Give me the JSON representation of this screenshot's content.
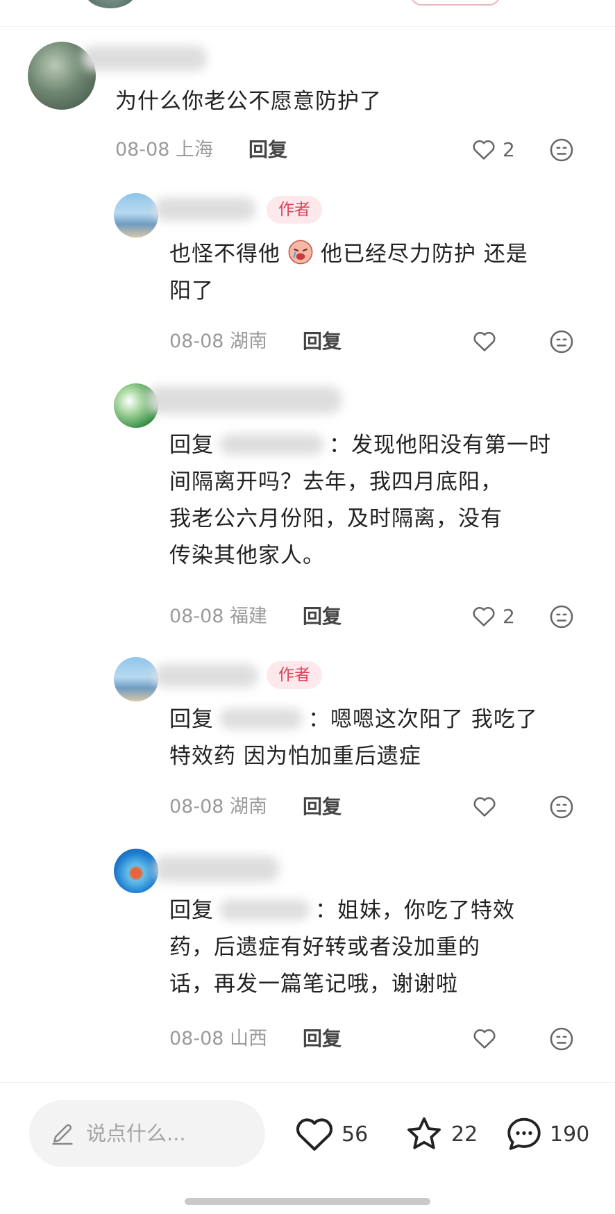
{
  "comments": [
    {
      "content": "为什么你老公不愿意防护了",
      "date": "08-08 上海",
      "reply_label": "回复",
      "likes": "2"
    },
    {
      "author_badge": "作者",
      "content_a": "也怪不得他",
      "content_b": "他已经尽力防护 还是",
      "content_c": "阳了",
      "date": "08-08 湖南",
      "reply_label": "回复",
      "likes": ""
    },
    {
      "reply_prefix": "回复",
      "line1": "：发现他阳没有第一时",
      "line2": "间隔离开吗？去年，我四月底阳，",
      "line3": "我老公六月份阳，及时隔离，没有",
      "line4": "传染其他家人。",
      "date": "08-08 福建",
      "reply_label": "回复",
      "likes": "2"
    },
    {
      "author_badge": "作者",
      "reply_prefix": "回复",
      "line1": "：嗯嗯这次阳了 我吃了",
      "line2": "特效药 因为怕加重后遗症",
      "date": "08-08 湖南",
      "reply_label": "回复",
      "likes": ""
    },
    {
      "reply_prefix": "回复",
      "line1": "：姐妹，你吃了特效",
      "line2": "药，后遗症有好转或者没加重的",
      "line3": "话，再发一篇笔记哦，谢谢啦",
      "date": "08-08 山西",
      "reply_label": "回复",
      "likes": ""
    }
  ],
  "bottom_bar": {
    "placeholder": "说点什么...",
    "like_count": "56",
    "star_count": "22",
    "comment_count": "190"
  },
  "icons": {
    "heart": "heart-icon",
    "dislike": "meh-face-icon",
    "pencil": "pencil-icon",
    "star": "star-icon",
    "chat": "chat-bubble-icon",
    "emoji": "crying-face-emoji"
  },
  "colors": {
    "author_badge_bg": "#fde9ec",
    "author_badge_text": "#e0405a",
    "meta_text": "#9a9a9a"
  }
}
